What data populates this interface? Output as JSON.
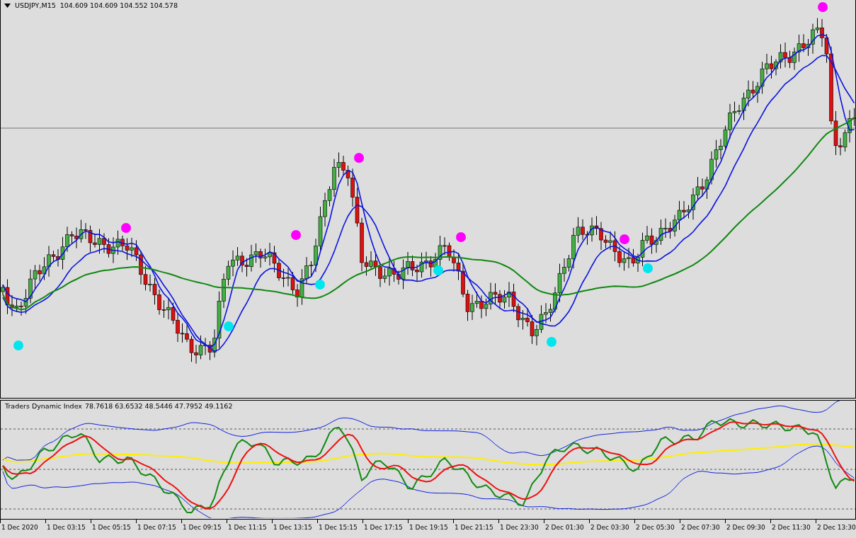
{
  "chart_header": {
    "symbol": "USDJPY,M15",
    "prices": "104.609 104.609 104.552 104.578"
  },
  "indicator": {
    "name": "Traders Dynamic Index",
    "values": "78.7618 63.6532 48.5446 47.7952 49.1162"
  },
  "time_axis": [
    "1 Dec 2020",
    "1 Dec 03:15",
    "1 Dec 05:15",
    "1 Dec 07:15",
    "1 Dec 09:15",
    "1 Dec 11:15",
    "1 Dec 13:15",
    "1 Dec 15:15",
    "1 Dec 17:15",
    "1 Dec 19:15",
    "1 Dec 21:15",
    "1 Dec 23:30",
    "2 Dec 01:30",
    "2 Dec 03:30",
    "2 Dec 05:30",
    "2 Dec 07:30",
    "2 Dec 09:30",
    "2 Dec 11:30",
    "2 Dec 13:30"
  ]
}
